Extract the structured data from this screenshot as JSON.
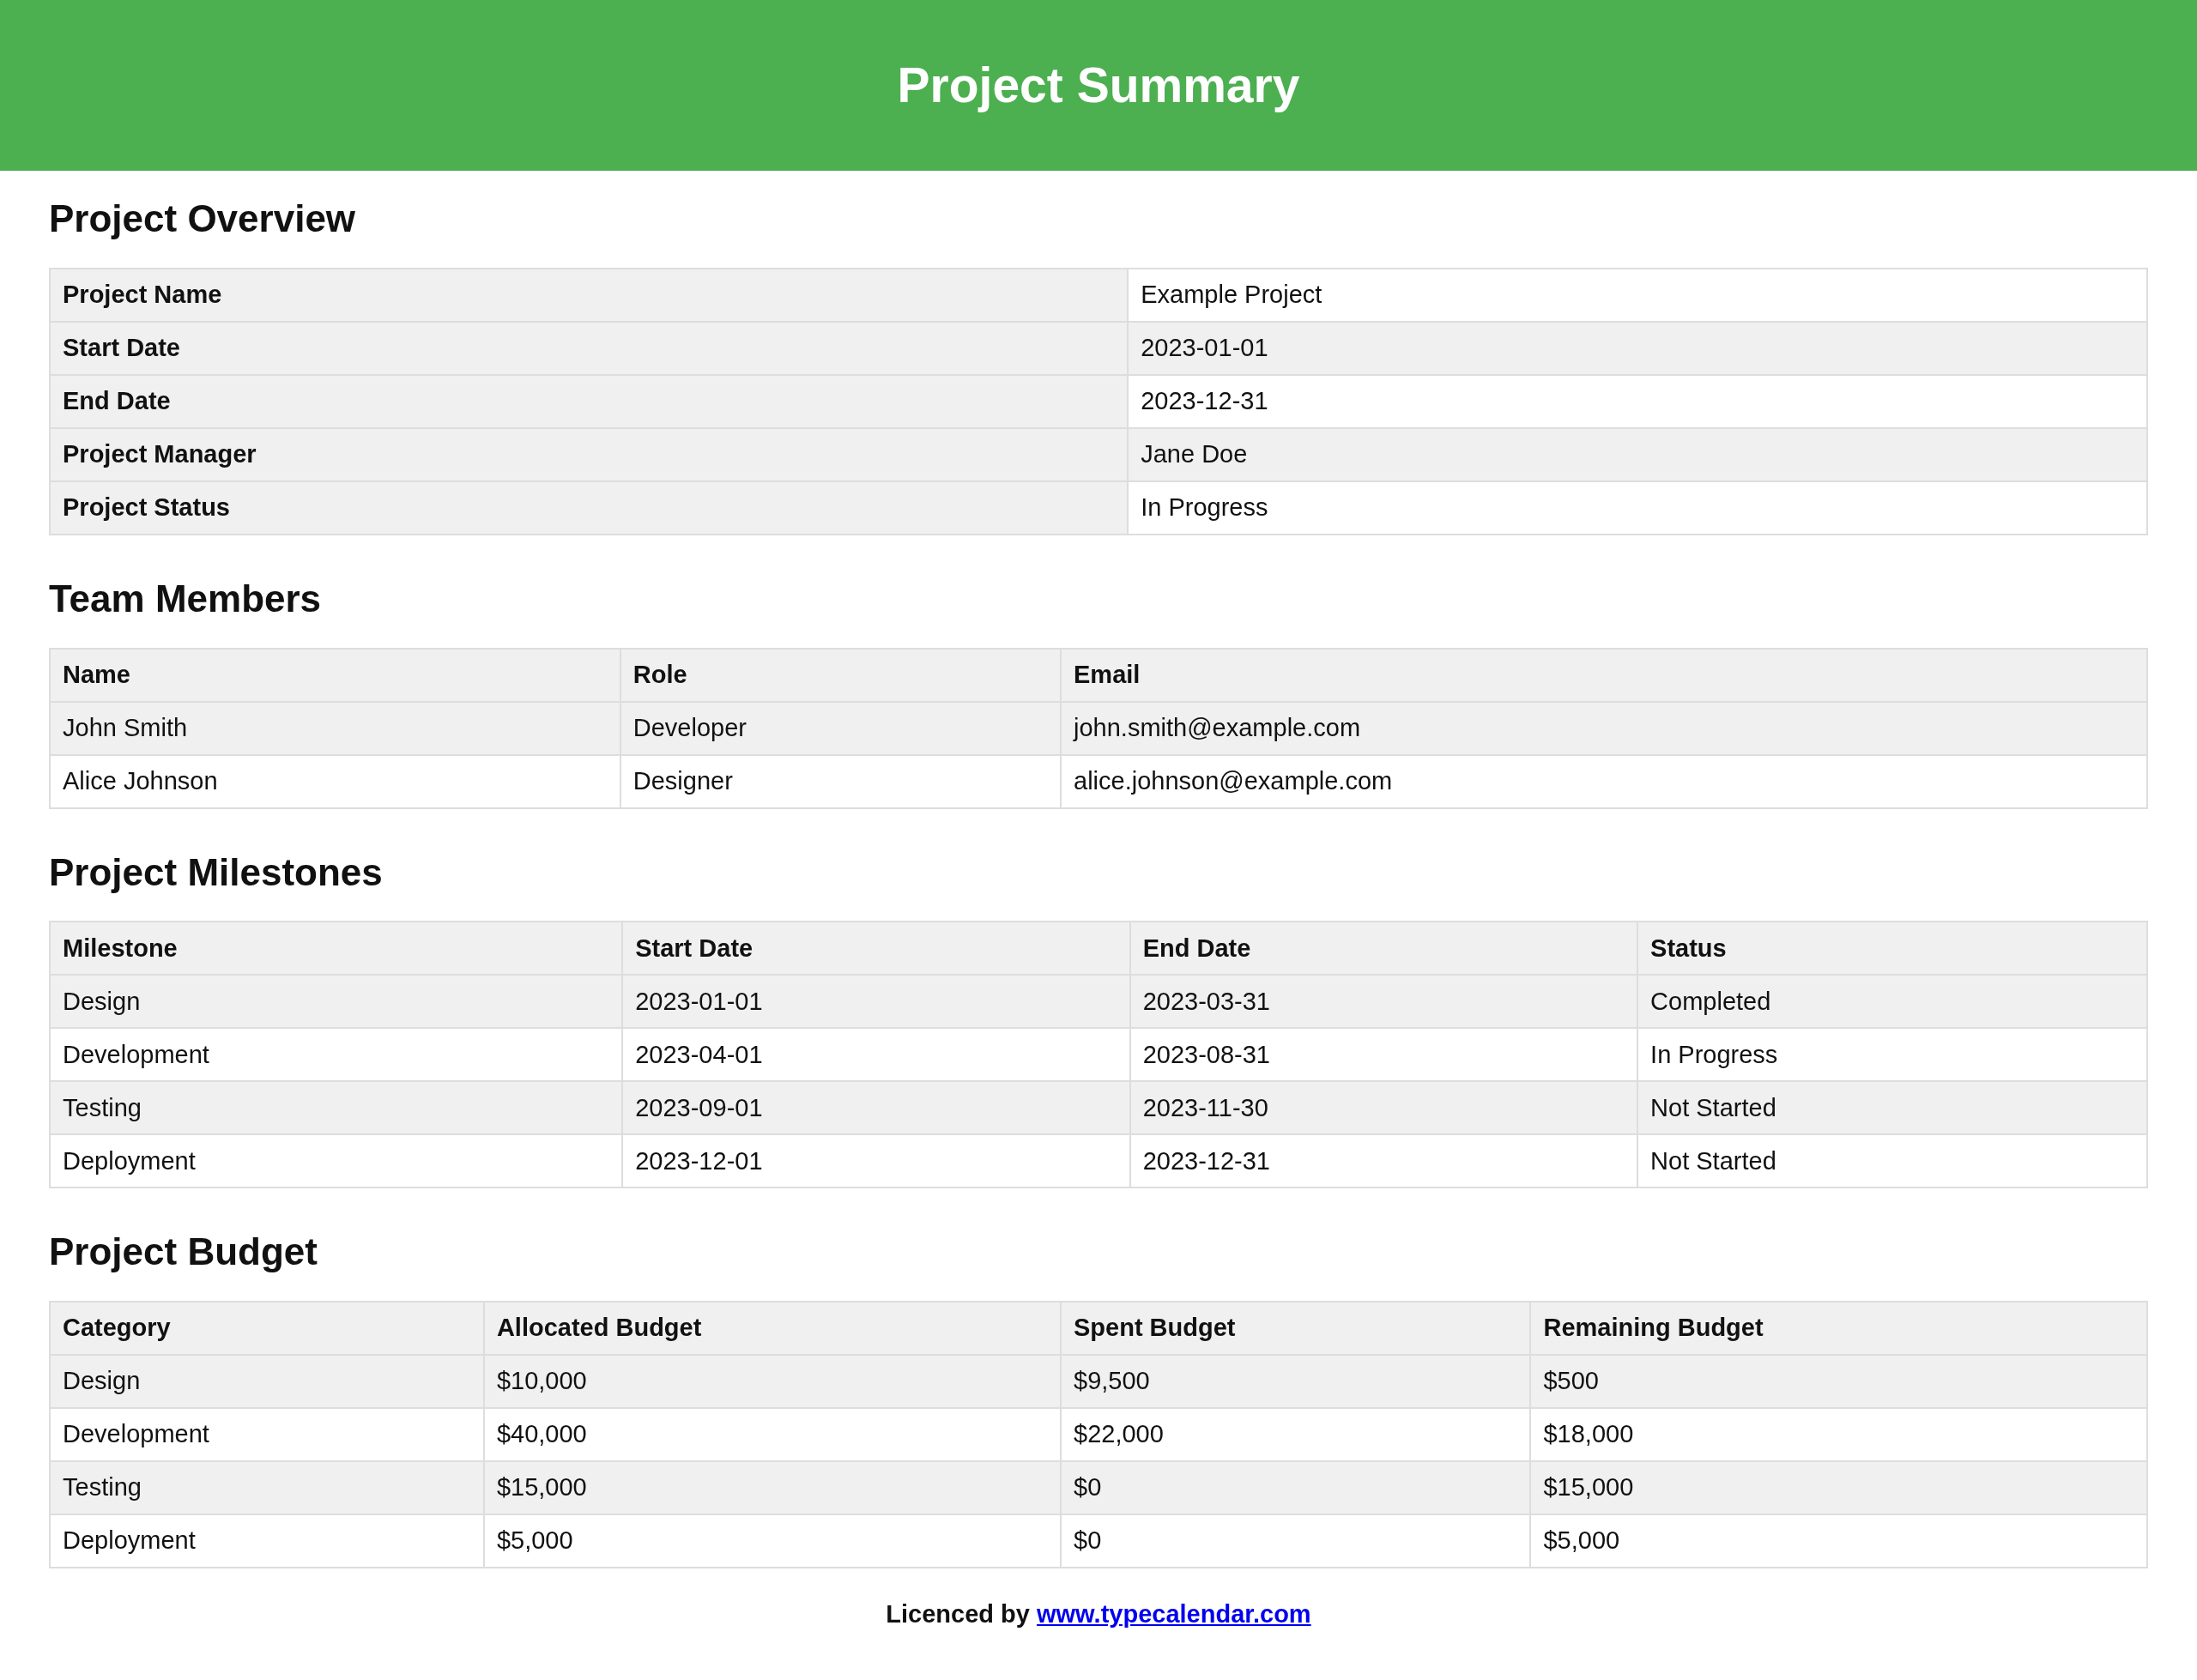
{
  "header": {
    "title": "Project Summary"
  },
  "sections": [
    {
      "heading": "Project Overview",
      "kind": "key_value",
      "rows": [
        [
          "Project Name",
          "Example Project"
        ],
        [
          "Start Date",
          "2023-01-01"
        ],
        [
          "End Date",
          "2023-12-31"
        ],
        [
          "Project Manager",
          "Jane Doe"
        ],
        [
          "Project Status",
          "In Progress"
        ]
      ]
    },
    {
      "heading": "Team Members",
      "kind": "grid",
      "columns": [
        "Name",
        "Role",
        "Email"
      ],
      "rows": [
        [
          "John Smith",
          "Developer",
          "john.smith@example.com"
        ],
        [
          "Alice Johnson",
          "Designer",
          "alice.johnson@example.com"
        ]
      ]
    },
    {
      "heading": "Project Milestones",
      "kind": "grid",
      "columns": [
        "Milestone",
        "Start Date",
        "End Date",
        "Status"
      ],
      "rows": [
        [
          "Design",
          "2023-01-01",
          "2023-03-31",
          "Completed"
        ],
        [
          "Development",
          "2023-04-01",
          "2023-08-31",
          "In Progress"
        ],
        [
          "Testing",
          "2023-09-01",
          "2023-11-30",
          "Not Started"
        ],
        [
          "Deployment",
          "2023-12-01",
          "2023-12-31",
          "Not Started"
        ]
      ]
    },
    {
      "heading": "Project Budget",
      "kind": "grid",
      "columns": [
        "Category",
        "Allocated Budget",
        "Spent Budget",
        "Remaining Budget"
      ],
      "rows": [
        [
          "Design",
          "$10,000",
          "$9,500",
          "$500"
        ],
        [
          "Development",
          "$40,000",
          "$22,000",
          "$18,000"
        ],
        [
          "Testing",
          "$15,000",
          "$0",
          "$15,000"
        ],
        [
          "Deployment",
          "$5,000",
          "$0",
          "$5,000"
        ]
      ]
    }
  ],
  "footer": {
    "text": "Licenced by",
    "link": "www.typecalendar.com"
  }
}
